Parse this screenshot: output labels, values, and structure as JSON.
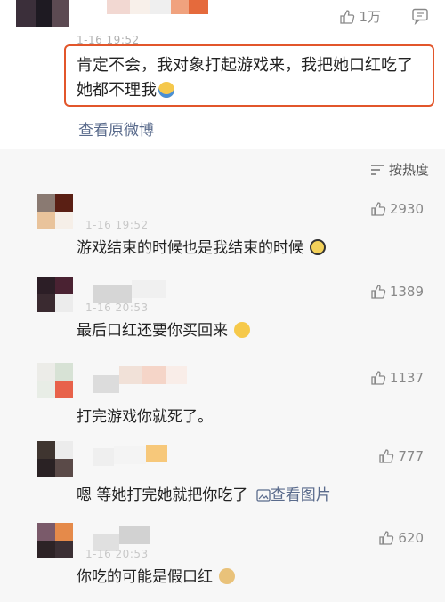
{
  "original_post": {
    "time": "1-16 19:52",
    "likes": "1万",
    "text": "肯定不会，我对象打起游戏来，我把她口红吃了她都不理我",
    "emoji": "shrug-emoji",
    "view_original": "查看原微博"
  },
  "sort_label": "按热度",
  "comments": [
    {
      "time": "1-16 19:52",
      "likes": "2930",
      "text": "游戏结束的时候也是我结束的时候",
      "emoji": "crying-face-emoji",
      "image_link": ""
    },
    {
      "time": "1-16 20:53",
      "likes": "1389",
      "text": "最后口红还要你买回来",
      "emoji": "laughing-face-emoji",
      "image_link": ""
    },
    {
      "time": "",
      "likes": "1137",
      "text": "打完游戏你就死了。",
      "emoji": "",
      "image_link": ""
    },
    {
      "time": "",
      "likes": "777",
      "text": "嗯 等她打完她就把你吃了",
      "emoji": "",
      "image_link": "查看图片"
    },
    {
      "time": "1-16 20:53",
      "likes": "620",
      "text": "你吃的可能是假口红",
      "emoji": "doge-emoji",
      "image_link": ""
    }
  ],
  "colors": {
    "highlight": "#e2562b",
    "link": "#5a6b8c",
    "muted": "#888888",
    "list_bg": "#f7f7f7"
  }
}
